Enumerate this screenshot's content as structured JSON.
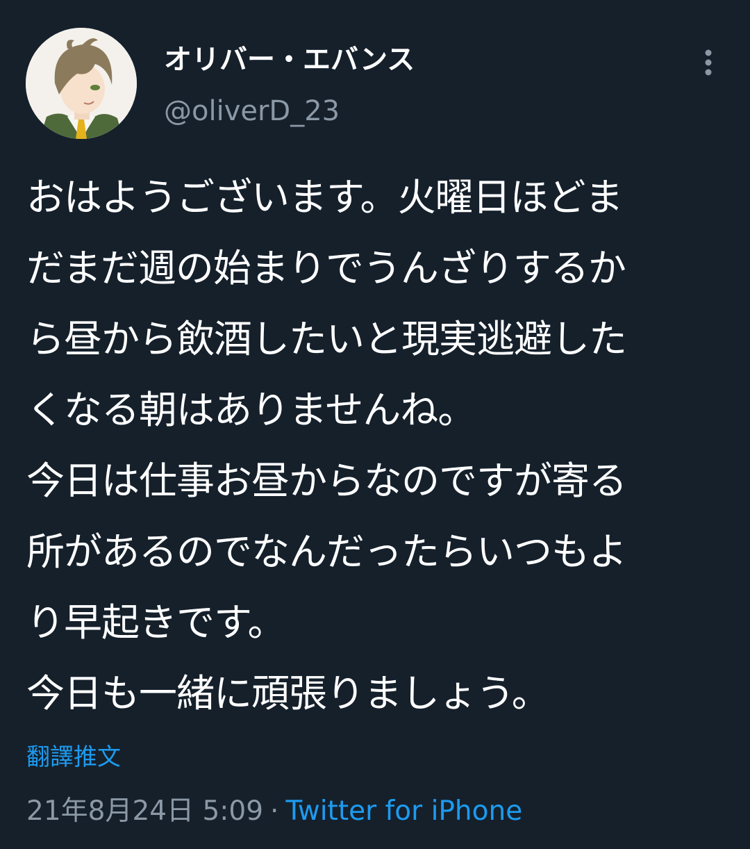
{
  "user": {
    "display_name": "オリバー・エバンス",
    "handle": "@oliverD_23"
  },
  "tweet": {
    "lines": [
      "おはようございます。火曜日ほどま",
      "だまだ週の始まりでうんざりするか",
      "ら昼から飲酒したいと現実逃避した",
      "くなる朝はありませんね。",
      "今日は仕事お昼からなのですが寄る",
      "所があるのでなんだったらいつもよ",
      "り早起きです。",
      "今日も一緒に頑張りましょう。"
    ],
    "translate_label": "翻譯推文",
    "timestamp": "21年8月24日 5:09",
    "separator": "·",
    "source": "Twitter for iPhone"
  },
  "icons": {
    "more": "more-vertical-icon"
  },
  "colors": {
    "background": "#15202b",
    "text": "#ffffff",
    "secondary": "#8b98a5",
    "accent": "#1d9bf0"
  }
}
